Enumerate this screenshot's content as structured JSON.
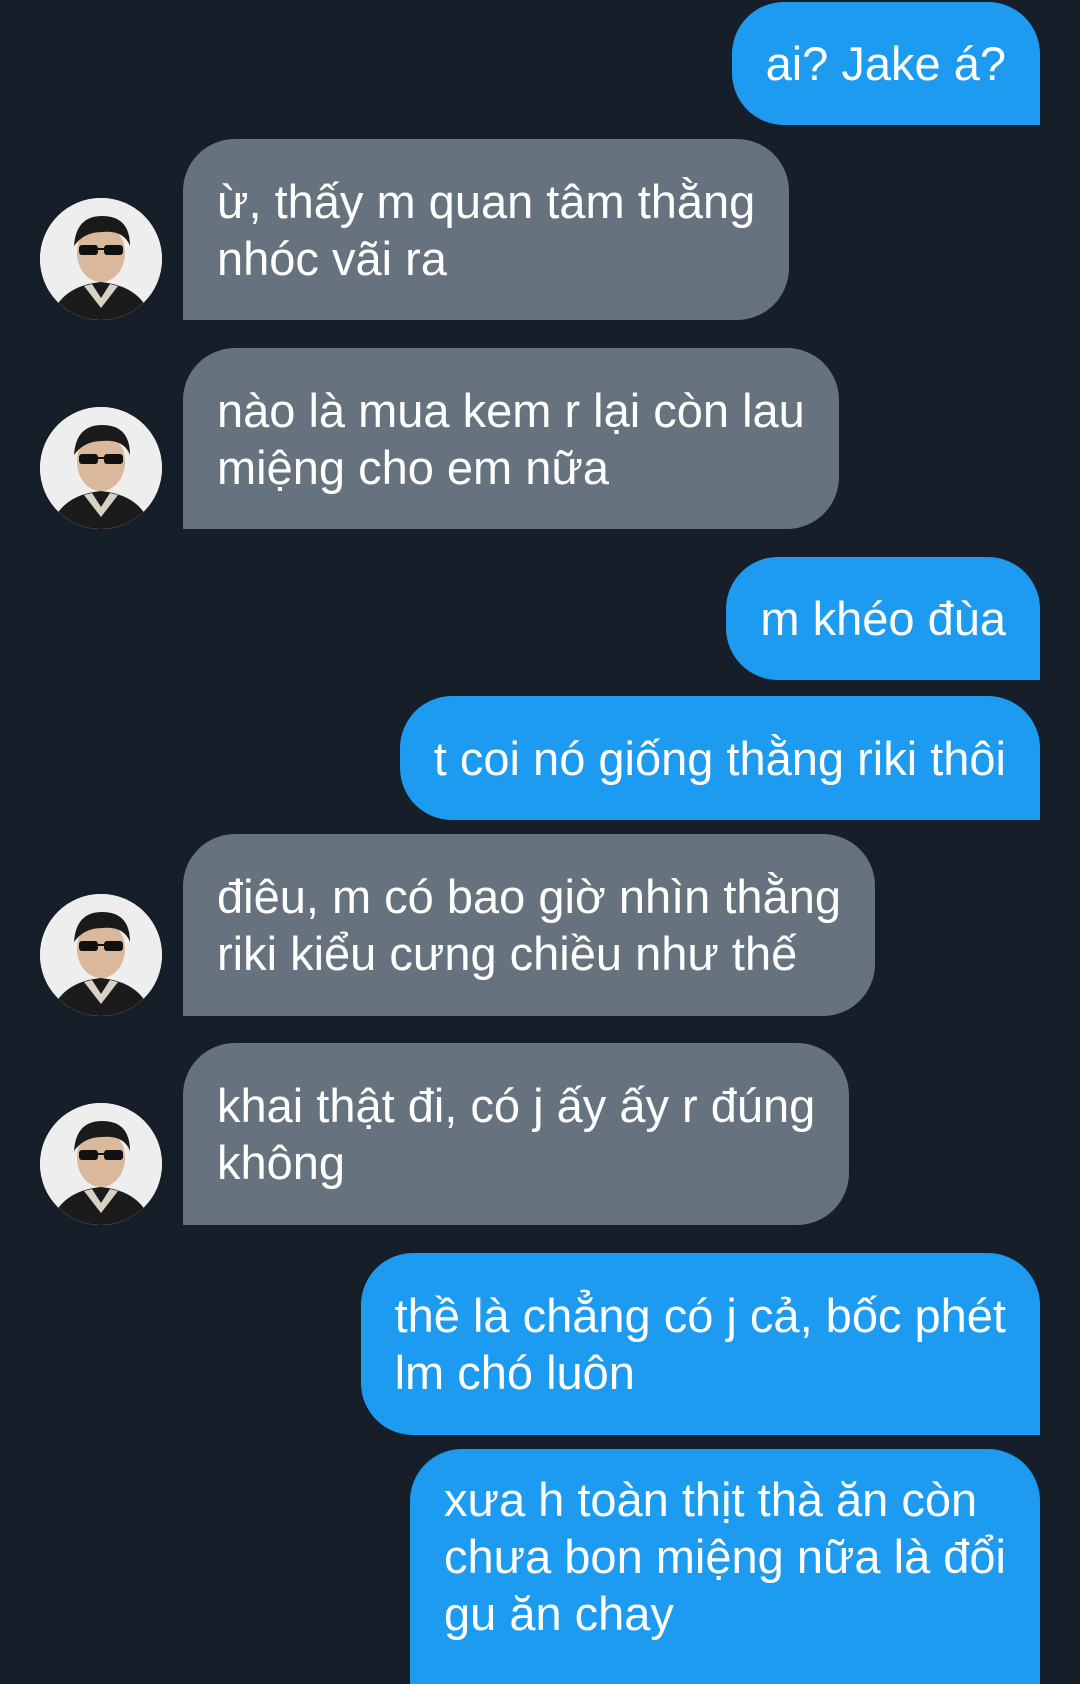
{
  "messages": [
    {
      "from": "me",
      "text": "ai? Jake á?"
    },
    {
      "from": "them",
      "text": "ừ, thấy m quan tâm thằng\nnhóc vãi ra"
    },
    {
      "from": "them",
      "text": "nào là mua kem r lại còn lau\nmiệng cho em nữa"
    },
    {
      "from": "me",
      "text": "m khéo đùa"
    },
    {
      "from": "me",
      "text": "t coi nó giống thằng riki thôi"
    },
    {
      "from": "them",
      "text": "điêu, m có bao giờ nhìn thằng\nriki kiểu cưng chiều như thế"
    },
    {
      "from": "them",
      "text": "khai thật đi, có j ấy ấy r đúng\nkhông"
    },
    {
      "from": "me",
      "text": "thề là chẳng có j cả, bốc phét\nlm chó luôn"
    },
    {
      "from": "me",
      "text": "xưa h toàn thịt thà ăn còn\nchưa bon miệng nữa là đổi\ngu ăn chay"
    }
  ],
  "colors": {
    "background": "#151e29",
    "sent_bubble": "#1d9bf0",
    "received_bubble": "#66737f",
    "text": "#ffffff"
  },
  "icons": {
    "avatar": "avatar-photo-icon"
  }
}
